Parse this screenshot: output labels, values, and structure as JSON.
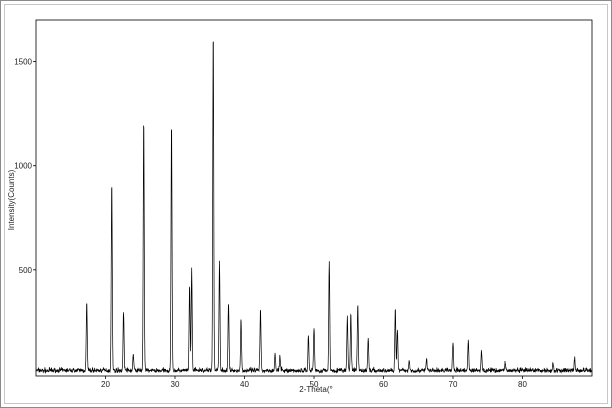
{
  "chart_data": {
    "type": "line",
    "title": "",
    "xlabel": "2-Theta(°",
    "ylabel": "Intensity(Counts)",
    "xlim": [
      10,
      90
    ],
    "ylim": [
      -10,
      1700
    ],
    "grid": false,
    "x_ticks": [
      20,
      30,
      40,
      50,
      60,
      70,
      80
    ],
    "y_ticks": [
      500,
      1000,
      1500
    ],
    "line_color": "#000000",
    "baseline": 12,
    "peaks": [
      {
        "x": 17.3,
        "y": 340
      },
      {
        "x": 20.9,
        "y": 930
      },
      {
        "x": 22.6,
        "y": 300
      },
      {
        "x": 24.0,
        "y": 90
      },
      {
        "x": 25.5,
        "y": 1230
      },
      {
        "x": 29.5,
        "y": 1215
      },
      {
        "x": 32.1,
        "y": 420
      },
      {
        "x": 32.4,
        "y": 500
      },
      {
        "x": 35.5,
        "y": 1660
      },
      {
        "x": 36.4,
        "y": 540
      },
      {
        "x": 37.7,
        "y": 340
      },
      {
        "x": 39.5,
        "y": 260
      },
      {
        "x": 42.3,
        "y": 310
      },
      {
        "x": 44.4,
        "y": 90
      },
      {
        "x": 45.1,
        "y": 80
      },
      {
        "x": 49.2,
        "y": 180
      },
      {
        "x": 50.0,
        "y": 220
      },
      {
        "x": 52.2,
        "y": 540
      },
      {
        "x": 54.8,
        "y": 270
      },
      {
        "x": 55.3,
        "y": 290
      },
      {
        "x": 56.3,
        "y": 330
      },
      {
        "x": 57.8,
        "y": 170
      },
      {
        "x": 61.7,
        "y": 320
      },
      {
        "x": 62.0,
        "y": 210
      },
      {
        "x": 63.7,
        "y": 60
      },
      {
        "x": 66.2,
        "y": 70
      },
      {
        "x": 70.0,
        "y": 150
      },
      {
        "x": 72.2,
        "y": 160
      },
      {
        "x": 74.1,
        "y": 110
      },
      {
        "x": 77.5,
        "y": 50
      },
      {
        "x": 84.4,
        "y": 45
      },
      {
        "x": 87.5,
        "y": 75
      }
    ]
  }
}
